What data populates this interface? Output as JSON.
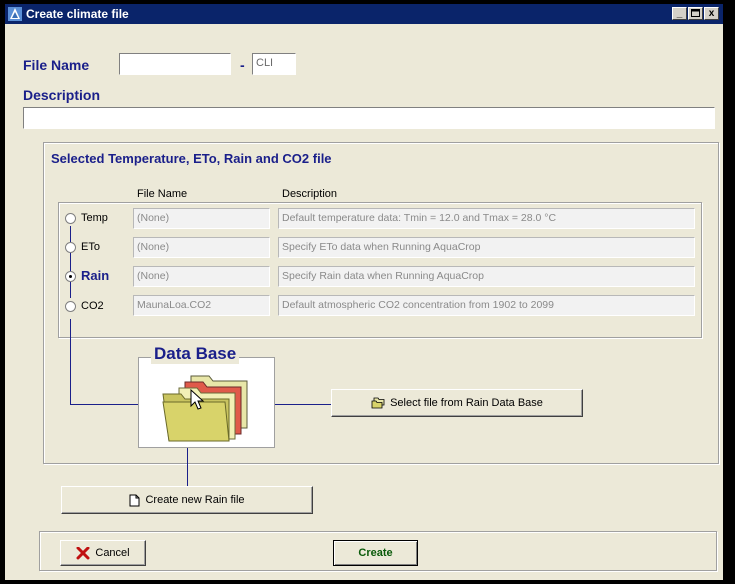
{
  "window": {
    "title": "Create climate file"
  },
  "filename": {
    "label": "File Name",
    "value": "",
    "separator": "-",
    "extension": "CLI"
  },
  "description": {
    "label": "Description",
    "value": ""
  },
  "group": {
    "title": "Selected Temperature, ETo, Rain and CO2 file",
    "col_filename": "File Name",
    "col_description": "Description",
    "rows": [
      {
        "label": "Temp",
        "file": "(None)",
        "desc": "Default temperature data: Tmin = 12.0 and Tmax = 28.0 °C",
        "selected": false
      },
      {
        "label": "ETo",
        "file": "(None)",
        "desc": "Specify ETo data when Running AquaCrop",
        "selected": false
      },
      {
        "label": "Rain",
        "file": "(None)",
        "desc": "Specify Rain data when Running AquaCrop",
        "selected": true
      },
      {
        "label": "CO2",
        "file": "MaunaLoa.CO2",
        "desc": "Default atmospheric CO2 concentration from 1902 to 2099",
        "selected": false
      }
    ],
    "database_title": "Data Base",
    "select_button": "Select file from Rain Data Base",
    "create_new_button": "Create new Rain file"
  },
  "footer": {
    "cancel": "Cancel",
    "create": "Create"
  },
  "colors": {
    "accent": "#1a1f8a",
    "titlebar": "#0a246a"
  }
}
